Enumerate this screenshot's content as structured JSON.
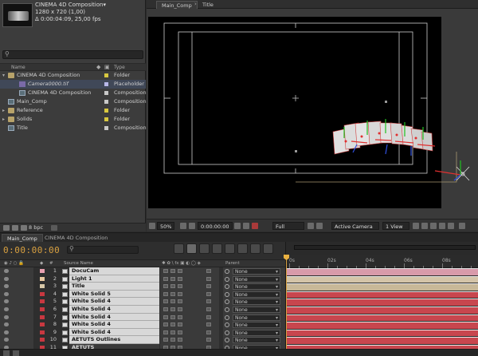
{
  "project": {
    "name": "CINEMA 4D Composition",
    "name_arrow": "▾",
    "info_line1": "1280 x 720 (1,00)",
    "info_line2": "Δ 0:00:04:09, 25,00 fps",
    "search_placeholder": "",
    "col_name": "Name",
    "col_type": "Type",
    "bpc": "8 bpc",
    "items": [
      {
        "name": "CINEMA 4D Composition",
        "type": "Folder",
        "icon": "folder-icon",
        "label_color": "#d8c840",
        "indent": 0,
        "twirl": "▾",
        "selected": false
      },
      {
        "name": "Camera0000.tif",
        "type": "Placeholder",
        "icon": "image-icon",
        "label_color": "#b8b8e8",
        "indent": 2,
        "twirl": "",
        "selected": true
      },
      {
        "name": "CINEMA 4D Composition",
        "type": "Composition",
        "icon": "composition-icon",
        "label_color": "#c8c8c8",
        "indent": 2,
        "twirl": "",
        "selected": false
      },
      {
        "name": "Main_Comp",
        "type": "Composition",
        "icon": "composition-icon",
        "label_color": "#c8c8c8",
        "indent": 0,
        "twirl": "",
        "selected": false
      },
      {
        "name": "Reference",
        "type": "Folder",
        "icon": "folder-icon",
        "label_color": "#d8c840",
        "indent": 0,
        "twirl": "▸",
        "selected": false
      },
      {
        "name": "Solids",
        "type": "Folder",
        "icon": "folder-icon",
        "label_color": "#d8c840",
        "indent": 0,
        "twirl": "▸",
        "selected": false
      },
      {
        "name": "Title",
        "type": "Composition",
        "icon": "composition-icon",
        "label_color": "#c8c8c8",
        "indent": 0,
        "twirl": "",
        "selected": false
      }
    ]
  },
  "viewer": {
    "tabs": [
      {
        "label": "Main_Comp",
        "active": true
      },
      {
        "label": "Title",
        "active": false
      }
    ],
    "tab_separator": "›",
    "zoom": "50%",
    "timecode": "0:00:00:00",
    "resolution": "Full",
    "camera": "Active Camera",
    "views": "1 View"
  },
  "timeline": {
    "tabs": [
      {
        "label": "Main_Comp",
        "active": true
      },
      {
        "label": "CINEMA 4D Composition",
        "active": false
      }
    ],
    "timecode": "0:00:00:00",
    "search_placeholder": "",
    "col_source": "Source Name",
    "col_parent": "Parent",
    "ruler": [
      "0s",
      "02s",
      "04s",
      "06s",
      "08s"
    ],
    "layers": [
      {
        "num": "1",
        "name": "DocuCam",
        "label_color": "#e8a0b0",
        "bar_color": "#d89aaa",
        "dark": false
      },
      {
        "num": "2",
        "name": "Light 1",
        "label_color": "#e8c8a0",
        "bar_color": "#d4c4a8",
        "dark": false
      },
      {
        "num": "3",
        "name": "Title",
        "label_color": "#d8c8a8",
        "bar_color": "#c8b898",
        "dark": false
      },
      {
        "num": "4",
        "name": "White Solid 5",
        "label_color": "#c83840",
        "bar_color": "#c8464e",
        "dark": false
      },
      {
        "num": "5",
        "name": "White Solid 4",
        "label_color": "#c83840",
        "bar_color": "#c8464e",
        "dark": false
      },
      {
        "num": "6",
        "name": "White Solid 4",
        "label_color": "#c83840",
        "bar_color": "#c8464e",
        "dark": false
      },
      {
        "num": "7",
        "name": "White Solid 4",
        "label_color": "#c83840",
        "bar_color": "#c8464e",
        "dark": false
      },
      {
        "num": "8",
        "name": "White Solid 4",
        "label_color": "#c83840",
        "bar_color": "#c8464e",
        "dark": false
      },
      {
        "num": "9",
        "name": "White Solid 4",
        "label_color": "#c83840",
        "bar_color": "#c8464e",
        "dark": false
      },
      {
        "num": "10",
        "name": "AETUTS Outlines",
        "label_color": "#c83840",
        "bar_color": "#c8464e",
        "dark": false
      },
      {
        "num": "11",
        "name": "AETUTS",
        "label_color": "#c83840",
        "bar_color": "#c8464e",
        "dark": true
      }
    ],
    "parent_value": "None"
  },
  "colors": {
    "accent_timecode": "#d8a040",
    "selection": "#404858"
  }
}
